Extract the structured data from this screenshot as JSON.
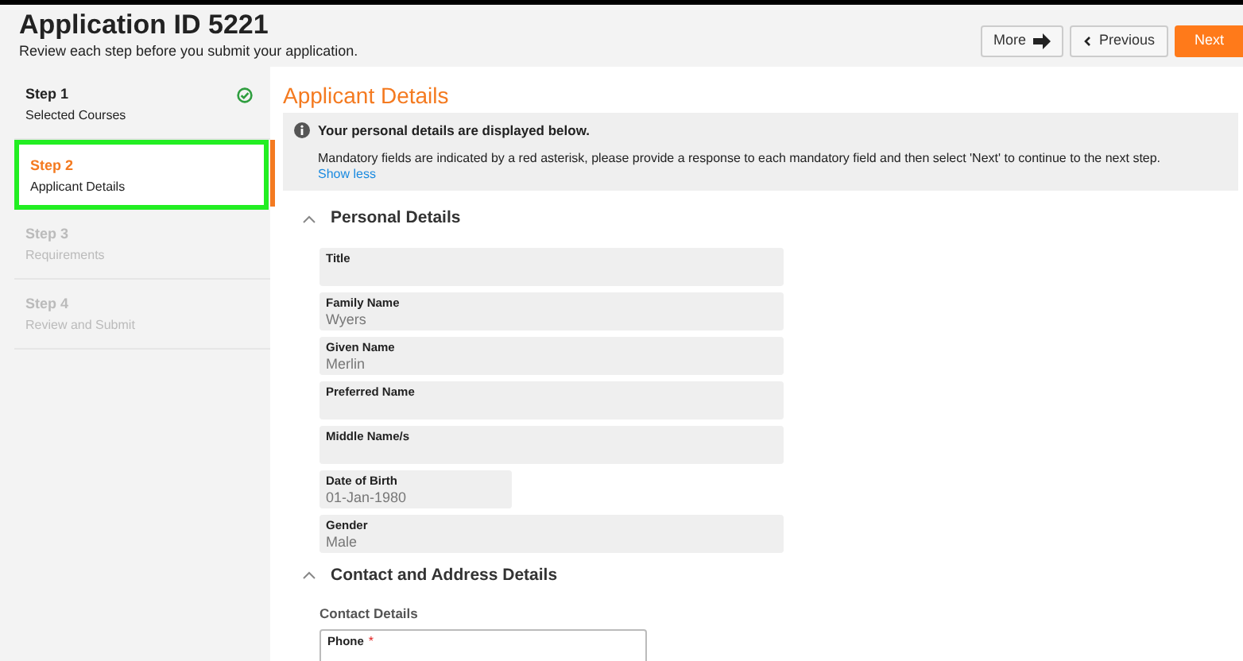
{
  "header": {
    "title": "Application ID 5221",
    "subtitle": "Review each step before you submit your application.",
    "buttons": [
      {
        "kind": "more",
        "label": "More"
      },
      {
        "kind": "previous",
        "label": "Previous"
      },
      {
        "kind": "next",
        "label": "Next"
      }
    ]
  },
  "steps": [
    {
      "label": "Step 1",
      "name": "Selected Courses",
      "selected": false,
      "completed": true,
      "disabled": false
    },
    {
      "label": "Step 2",
      "name": "Applicant Details",
      "selected": true,
      "completed": false,
      "disabled": false
    },
    {
      "label": "Step 3",
      "name": "Requirements",
      "selected": false,
      "completed": false,
      "disabled": true
    },
    {
      "label": "Step 4",
      "name": "Review and Submit",
      "selected": false,
      "completed": false,
      "disabled": true
    }
  ],
  "page_title": "Applicant Details",
  "info": {
    "heading": "Your personal details are displayed below.",
    "text": "Mandatory fields are indicated by a red asterisk, please provide a response to each mandatory field and then select 'Next' to continue to the next step.",
    "link": "Show less"
  },
  "sections": [
    {
      "title": "Personal Details",
      "expanded": true,
      "fields": [
        {
          "kind": "text",
          "label": "Title",
          "readonly": true
        },
        {
          "kind": "text",
          "label": "Family Name",
          "value": "Wyers",
          "readonly": true
        },
        {
          "kind": "text",
          "label": "Given Name",
          "value": "Merlin",
          "readonly": true
        },
        {
          "kind": "text",
          "label": "Preferred Name",
          "readonly": true
        },
        {
          "kind": "text",
          "label": "Middle Name/s",
          "readonly": true
        },
        {
          "kind": "date",
          "label": "Date of Birth",
          "value": "01-Jan-1980",
          "readonly": true
        },
        {
          "kind": "text",
          "label": "Gender",
          "value": "Male",
          "readonly": true
        }
      ]
    },
    {
      "title": "Contact and Address Details",
      "expanded": true,
      "subheading": "Contact Details",
      "fields": [
        {
          "kind": "text",
          "label": "Phone",
          "readonly": false,
          "required_mark": "*"
        }
      ]
    }
  ]
}
